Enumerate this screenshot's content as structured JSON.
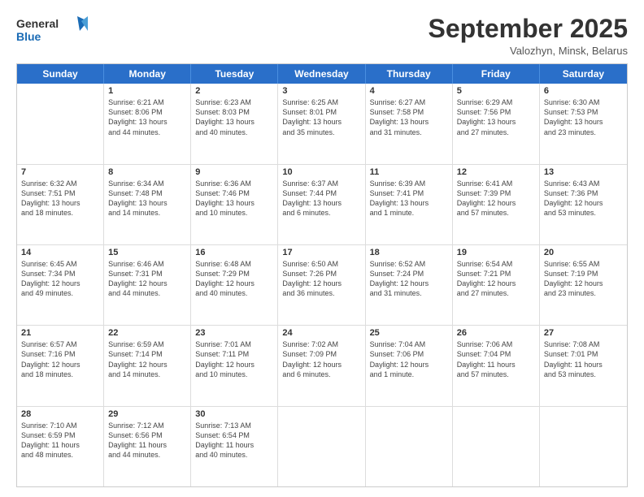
{
  "logo": {
    "general": "General",
    "blue": "Blue"
  },
  "title": "September 2025",
  "subtitle": "Valozhyn, Minsk, Belarus",
  "header": {
    "days": [
      "Sunday",
      "Monday",
      "Tuesday",
      "Wednesday",
      "Thursday",
      "Friday",
      "Saturday"
    ]
  },
  "rows": [
    [
      {
        "day": "",
        "lines": []
      },
      {
        "day": "1",
        "lines": [
          "Sunrise: 6:21 AM",
          "Sunset: 8:06 PM",
          "Daylight: 13 hours",
          "and 44 minutes."
        ]
      },
      {
        "day": "2",
        "lines": [
          "Sunrise: 6:23 AM",
          "Sunset: 8:03 PM",
          "Daylight: 13 hours",
          "and 40 minutes."
        ]
      },
      {
        "day": "3",
        "lines": [
          "Sunrise: 6:25 AM",
          "Sunset: 8:01 PM",
          "Daylight: 13 hours",
          "and 35 minutes."
        ]
      },
      {
        "day": "4",
        "lines": [
          "Sunrise: 6:27 AM",
          "Sunset: 7:58 PM",
          "Daylight: 13 hours",
          "and 31 minutes."
        ]
      },
      {
        "day": "5",
        "lines": [
          "Sunrise: 6:29 AM",
          "Sunset: 7:56 PM",
          "Daylight: 13 hours",
          "and 27 minutes."
        ]
      },
      {
        "day": "6",
        "lines": [
          "Sunrise: 6:30 AM",
          "Sunset: 7:53 PM",
          "Daylight: 13 hours",
          "and 23 minutes."
        ]
      }
    ],
    [
      {
        "day": "7",
        "lines": [
          "Sunrise: 6:32 AM",
          "Sunset: 7:51 PM",
          "Daylight: 13 hours",
          "and 18 minutes."
        ]
      },
      {
        "day": "8",
        "lines": [
          "Sunrise: 6:34 AM",
          "Sunset: 7:48 PM",
          "Daylight: 13 hours",
          "and 14 minutes."
        ]
      },
      {
        "day": "9",
        "lines": [
          "Sunrise: 6:36 AM",
          "Sunset: 7:46 PM",
          "Daylight: 13 hours",
          "and 10 minutes."
        ]
      },
      {
        "day": "10",
        "lines": [
          "Sunrise: 6:37 AM",
          "Sunset: 7:44 PM",
          "Daylight: 13 hours",
          "and 6 minutes."
        ]
      },
      {
        "day": "11",
        "lines": [
          "Sunrise: 6:39 AM",
          "Sunset: 7:41 PM",
          "Daylight: 13 hours",
          "and 1 minute."
        ]
      },
      {
        "day": "12",
        "lines": [
          "Sunrise: 6:41 AM",
          "Sunset: 7:39 PM",
          "Daylight: 12 hours",
          "and 57 minutes."
        ]
      },
      {
        "day": "13",
        "lines": [
          "Sunrise: 6:43 AM",
          "Sunset: 7:36 PM",
          "Daylight: 12 hours",
          "and 53 minutes."
        ]
      }
    ],
    [
      {
        "day": "14",
        "lines": [
          "Sunrise: 6:45 AM",
          "Sunset: 7:34 PM",
          "Daylight: 12 hours",
          "and 49 minutes."
        ]
      },
      {
        "day": "15",
        "lines": [
          "Sunrise: 6:46 AM",
          "Sunset: 7:31 PM",
          "Daylight: 12 hours",
          "and 44 minutes."
        ]
      },
      {
        "day": "16",
        "lines": [
          "Sunrise: 6:48 AM",
          "Sunset: 7:29 PM",
          "Daylight: 12 hours",
          "and 40 minutes."
        ]
      },
      {
        "day": "17",
        "lines": [
          "Sunrise: 6:50 AM",
          "Sunset: 7:26 PM",
          "Daylight: 12 hours",
          "and 36 minutes."
        ]
      },
      {
        "day": "18",
        "lines": [
          "Sunrise: 6:52 AM",
          "Sunset: 7:24 PM",
          "Daylight: 12 hours",
          "and 31 minutes."
        ]
      },
      {
        "day": "19",
        "lines": [
          "Sunrise: 6:54 AM",
          "Sunset: 7:21 PM",
          "Daylight: 12 hours",
          "and 27 minutes."
        ]
      },
      {
        "day": "20",
        "lines": [
          "Sunrise: 6:55 AM",
          "Sunset: 7:19 PM",
          "Daylight: 12 hours",
          "and 23 minutes."
        ]
      }
    ],
    [
      {
        "day": "21",
        "lines": [
          "Sunrise: 6:57 AM",
          "Sunset: 7:16 PM",
          "Daylight: 12 hours",
          "and 18 minutes."
        ]
      },
      {
        "day": "22",
        "lines": [
          "Sunrise: 6:59 AM",
          "Sunset: 7:14 PM",
          "Daylight: 12 hours",
          "and 14 minutes."
        ]
      },
      {
        "day": "23",
        "lines": [
          "Sunrise: 7:01 AM",
          "Sunset: 7:11 PM",
          "Daylight: 12 hours",
          "and 10 minutes."
        ]
      },
      {
        "day": "24",
        "lines": [
          "Sunrise: 7:02 AM",
          "Sunset: 7:09 PM",
          "Daylight: 12 hours",
          "and 6 minutes."
        ]
      },
      {
        "day": "25",
        "lines": [
          "Sunrise: 7:04 AM",
          "Sunset: 7:06 PM",
          "Daylight: 12 hours",
          "and 1 minute."
        ]
      },
      {
        "day": "26",
        "lines": [
          "Sunrise: 7:06 AM",
          "Sunset: 7:04 PM",
          "Daylight: 11 hours",
          "and 57 minutes."
        ]
      },
      {
        "day": "27",
        "lines": [
          "Sunrise: 7:08 AM",
          "Sunset: 7:01 PM",
          "Daylight: 11 hours",
          "and 53 minutes."
        ]
      }
    ],
    [
      {
        "day": "28",
        "lines": [
          "Sunrise: 7:10 AM",
          "Sunset: 6:59 PM",
          "Daylight: 11 hours",
          "and 48 minutes."
        ]
      },
      {
        "day": "29",
        "lines": [
          "Sunrise: 7:12 AM",
          "Sunset: 6:56 PM",
          "Daylight: 11 hours",
          "and 44 minutes."
        ]
      },
      {
        "day": "30",
        "lines": [
          "Sunrise: 7:13 AM",
          "Sunset: 6:54 PM",
          "Daylight: 11 hours",
          "and 40 minutes."
        ]
      },
      {
        "day": "",
        "lines": []
      },
      {
        "day": "",
        "lines": []
      },
      {
        "day": "",
        "lines": []
      },
      {
        "day": "",
        "lines": []
      }
    ]
  ]
}
